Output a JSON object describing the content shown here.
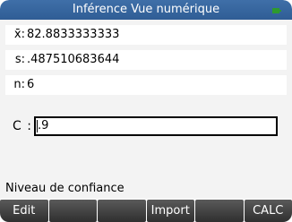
{
  "window": {
    "title": "Inférence Vue numérique"
  },
  "fields": [
    {
      "label": "x̄:",
      "value": "82.8833333333"
    },
    {
      "label": "s:",
      "value": ".487510683644"
    },
    {
      "label": "n:",
      "value": "6"
    }
  ],
  "confidence_field": {
    "label": "C :",
    "value": ".9"
  },
  "help_text": "Niveau de confiance",
  "softkeys": [
    "Edit",
    "",
    "",
    "Import",
    "",
    "CALC"
  ],
  "colors": {
    "title_bar": "#2f5d95",
    "background": "#f3f3f3",
    "softkey": "#3a3a3a",
    "battery": "#2e9a2e"
  },
  "icons": {
    "battery": "battery-icon"
  }
}
